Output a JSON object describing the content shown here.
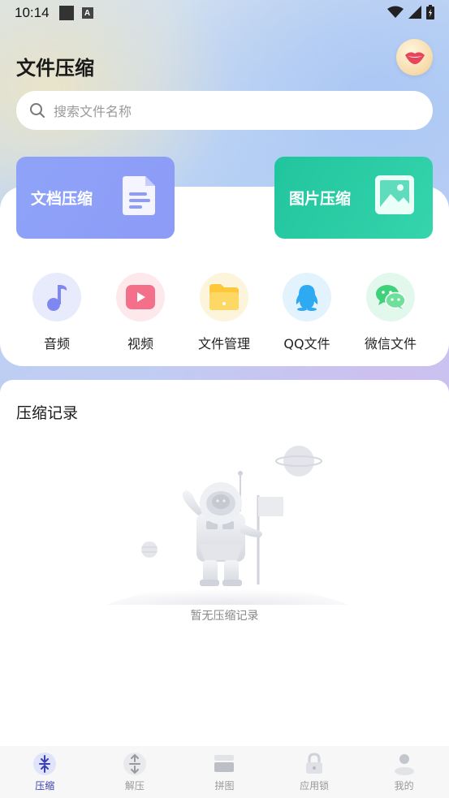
{
  "status_bar": {
    "time": "10:14"
  },
  "header": {
    "title": "文件压缩"
  },
  "search": {
    "placeholder": "搜索文件名称"
  },
  "feature_cards": [
    {
      "label": "文档压缩",
      "icon": "document-icon",
      "color": "#8ea3f8"
    },
    {
      "label": "图片压缩",
      "icon": "image-icon",
      "color": "#21c59d"
    }
  ],
  "categories": [
    {
      "label": "音频",
      "icon": "music-note-icon"
    },
    {
      "label": "视频",
      "icon": "video-play-icon"
    },
    {
      "label": "文件管理",
      "icon": "folder-icon"
    },
    {
      "label": "QQ文件",
      "icon": "qq-penguin-icon"
    },
    {
      "label": "微信文件",
      "icon": "wechat-icon"
    }
  ],
  "records": {
    "title": "压缩记录",
    "empty_text": "暂无压缩记录"
  },
  "bottom_nav": [
    {
      "label": "压缩",
      "icon": "compress-icon",
      "active": true
    },
    {
      "label": "解压",
      "icon": "decompress-icon",
      "active": false
    },
    {
      "label": "拼图",
      "icon": "collage-icon",
      "active": false
    },
    {
      "label": "应用锁",
      "icon": "lock-icon",
      "active": false
    },
    {
      "label": "我的",
      "icon": "profile-icon",
      "active": false
    }
  ],
  "colors": {
    "accent": "#3a3fb0",
    "doc_card": "#8ea3f8",
    "img_card": "#21c59d"
  }
}
